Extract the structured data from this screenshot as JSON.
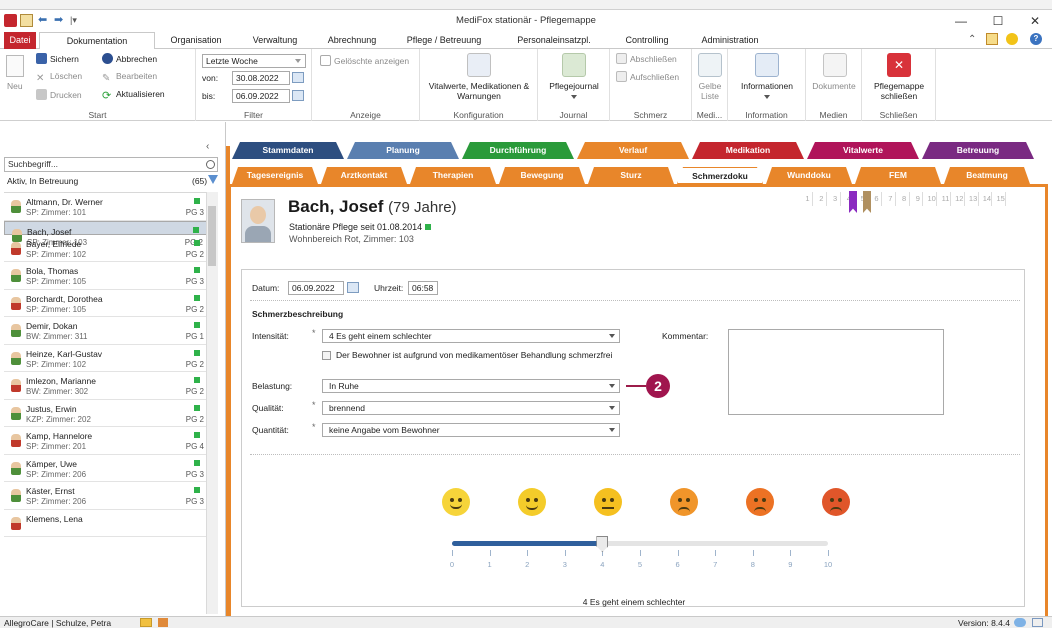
{
  "app": {
    "title": "MediFox stationär - Pflegemappe"
  },
  "colors": {
    "file_tab": "#c4262e",
    "status_green": "#2fb24a",
    "tab_orange": "#e8862a",
    "selected_row": "#cfd8e3"
  },
  "menu": {
    "tabs": [
      "Datei",
      "Dokumentation",
      "Organisation",
      "Verwaltung",
      "Abrechnung",
      "Pflege / Betreuung",
      "Personaleinsatzpl.",
      "Controlling",
      "Administration"
    ]
  },
  "ribbon": {
    "neu": "Neu",
    "sichern": "Sichern",
    "abbrechen": "Abbrechen",
    "loeschen": "Löschen",
    "bearbeiten": "Bearbeiten",
    "drucken": "Drucken",
    "aktualisieren": "Aktualisieren",
    "group_start": "Start",
    "filter_period": "Letzte Woche",
    "von_label": "von:",
    "von_value": "30.08.2022",
    "bis_label": "bis:",
    "bis_value": "06.09.2022",
    "group_filter": "Filter",
    "geloeschte": "Gelöschte anzeigen",
    "group_anzeige": "Anzeige",
    "vitalwerte_btn": "Vitalwerte, Medikationen & Warnungen",
    "group_konfiguration": "Konfiguration",
    "pflegejournal": "Pflegejournal",
    "group_journal": "Journal",
    "abschliessen": "Abschließen",
    "aufschliessen": "Aufschließen",
    "group_schmerz": "Schmerz",
    "gelbe_liste": "Gelbe Liste",
    "group_medi": "Medi...",
    "informationen": "Informationen",
    "group_information": "Information",
    "dokumente": "Dokumente",
    "group_medien": "Medien",
    "pflegemappe_schliessen": "Pflegemappe schließen",
    "group_schliessen": "Schließen"
  },
  "sidebar": {
    "search_placeholder": "Suchbegriff...",
    "filter": "Aktiv, In Betreuung",
    "count": "(65)",
    "residents": [
      {
        "name": "Altmann, Dr. Werner",
        "room": "SP: Zimmer: 101",
        "pg": "PG 3",
        "gender": "m"
      },
      {
        "name": "Bach, Josef",
        "room": "SP: Zimmer: 103",
        "pg": "PG 2",
        "gender": "m",
        "selected": true
      },
      {
        "name": "Bayer, Elfriede",
        "room": "SP: Zimmer: 102",
        "pg": "PG 2",
        "gender": "f"
      },
      {
        "name": "Bola, Thomas",
        "room": "SP: Zimmer: 105",
        "pg": "PG 3",
        "gender": "m"
      },
      {
        "name": "Borchardt, Dorothea",
        "room": "SP: Zimmer: 105",
        "pg": "PG 2",
        "gender": "f"
      },
      {
        "name": "Demir, Dokan",
        "room": "BW: Zimmer: 311",
        "pg": "PG 1",
        "gender": "m"
      },
      {
        "name": "Heinze, Karl-Gustav",
        "room": "SP: Zimmer: 102",
        "pg": "PG 2",
        "gender": "m"
      },
      {
        "name": "Imlezon, Marianne",
        "room": "BW: Zimmer: 302",
        "pg": "PG 2",
        "gender": "f"
      },
      {
        "name": "Justus, Erwin",
        "room": "KZP: Zimmer: 202",
        "pg": "PG 2",
        "gender": "m"
      },
      {
        "name": "Kamp, Hannelore",
        "room": "SP: Zimmer: 201",
        "pg": "PG 4",
        "gender": "f"
      },
      {
        "name": "Kämper, Uwe",
        "room": "SP: Zimmer: 206",
        "pg": "PG 3",
        "gender": "m"
      },
      {
        "name": "Käster, Ernst",
        "room": "SP: Zimmer: 206",
        "pg": "PG 3",
        "gender": "m"
      },
      {
        "name": "Klemens, Lena",
        "room": "",
        "pg": "",
        "gender": "f"
      }
    ]
  },
  "tabs_row1": [
    {
      "label": "Stammdaten",
      "color": "#2d4e80"
    },
    {
      "label": "Planung",
      "color": "#5a7fb0"
    },
    {
      "label": "Durchführung",
      "color": "#2a9a3a"
    },
    {
      "label": "Verlauf",
      "color": "#e8862a"
    },
    {
      "label": "Medikation",
      "color": "#c4262e"
    },
    {
      "label": "Vitalwerte",
      "color": "#b0145a"
    },
    {
      "label": "Betreuung",
      "color": "#7a2a82"
    }
  ],
  "tabs_row2": [
    "Tagesereignis",
    "Arztkontakt",
    "Therapien",
    "Bewegung",
    "Sturz",
    "Schmerzdoku",
    "Wunddoku",
    "FEM",
    "Beatmung"
  ],
  "patient": {
    "name": "Bach, Josef",
    "age": "(79 Jahre)",
    "care": "Stationäre Pflege seit 01.08.2014",
    "area": "Wohnbereich Rot, Zimmer: 103"
  },
  "page_numbers": [
    "1",
    "2",
    "3",
    "4",
    "5",
    "6",
    "7",
    "8",
    "9",
    "10",
    "11",
    "12",
    "13",
    "14",
    "15"
  ],
  "form": {
    "datum_label": "Datum:",
    "datum": "06.09.2022",
    "uhrzeit_label": "Uhrzeit:",
    "uhrzeit": "06:58",
    "section": "Schmerzbeschreibung",
    "intensitaet_label": "Intensität:",
    "intensitaet": "4  Es geht einem schlechter",
    "checkbox": "Der Bewohner ist aufgrund von medikamentöser Behandlung schmerzfrei",
    "belastung_label": "Belastung:",
    "belastung": "In Ruhe",
    "qualitaet_label": "Qualität:",
    "qualitaet": "brennend",
    "quantitaet_label": "Quantität:",
    "quantitaet": "keine Angabe vom Bewohner",
    "kommentar_label": "Kommentar:",
    "required": "*",
    "callout": "2",
    "faces": [
      {
        "color": "#f6d43a",
        "mood": "happy"
      },
      {
        "color": "#f4cc2a",
        "mood": "smile"
      },
      {
        "color": "#f5c020",
        "mood": "neutral"
      },
      {
        "color": "#f0952a",
        "mood": "sad"
      },
      {
        "color": "#ec7224",
        "mood": "sadder"
      },
      {
        "color": "#e0562a",
        "mood": "saddest"
      }
    ],
    "scale_ticks": [
      "0",
      "1",
      "2",
      "3",
      "4",
      "5",
      "6",
      "7",
      "8",
      "9",
      "10"
    ],
    "scale_value": 4,
    "scale_caption": "4  Es geht einem schlechter"
  },
  "status": {
    "left": "AllegroCare | Schulze, Petra",
    "version": "Version: 8.4.4"
  }
}
